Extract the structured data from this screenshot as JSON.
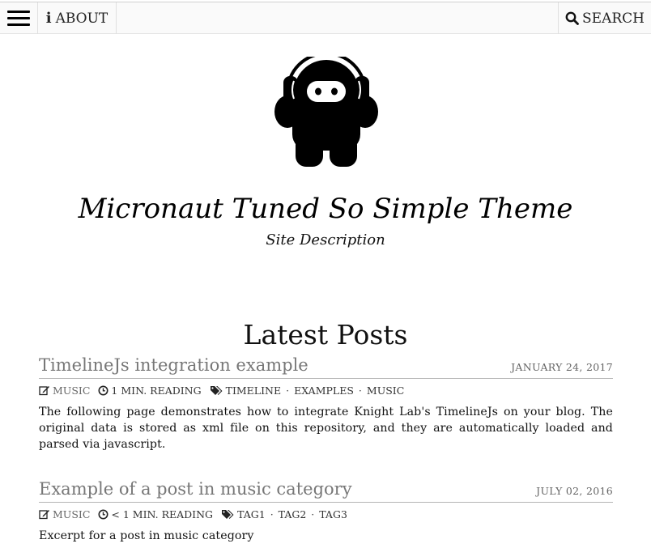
{
  "nav": {
    "about_label": "ABOUT",
    "search_label": "SEARCH",
    "menu_icon": "hamburger-icon",
    "about_icon": "info-icon",
    "search_icon": "search-icon"
  },
  "site": {
    "title": "Micronaut Tuned So Simple Theme",
    "description": "Site Description",
    "logo_icon": "ninja-headphones-logo"
  },
  "main": {
    "heading": "Latest Posts",
    "posts": [
      {
        "title": "TimelineJs integration example",
        "date": "JANUARY 24, 2017",
        "category": "MUSIC",
        "reading_time": "1 MIN. READING",
        "tags": [
          "TIMELINE",
          "EXAMPLES",
          "MUSIC"
        ],
        "excerpt": "The following page demonstrates how to integrate Knight Lab's TimelineJs on your blog. The original data is stored as xml file on this repository, and they are automatically loaded and parsed via javascript."
      },
      {
        "title": "Example of a post in music category",
        "date": "JULY 02, 2016",
        "category": "MUSIC",
        "reading_time": "< 1 MIN. READING",
        "tags": [
          "TAG1",
          "TAG2",
          "TAG3"
        ],
        "excerpt": "Excerpt for a post in music category"
      }
    ]
  },
  "colors": {
    "background": "#ffffff",
    "navbar_background": "#fafafa",
    "post_title": "#777777",
    "text": "#111111"
  }
}
